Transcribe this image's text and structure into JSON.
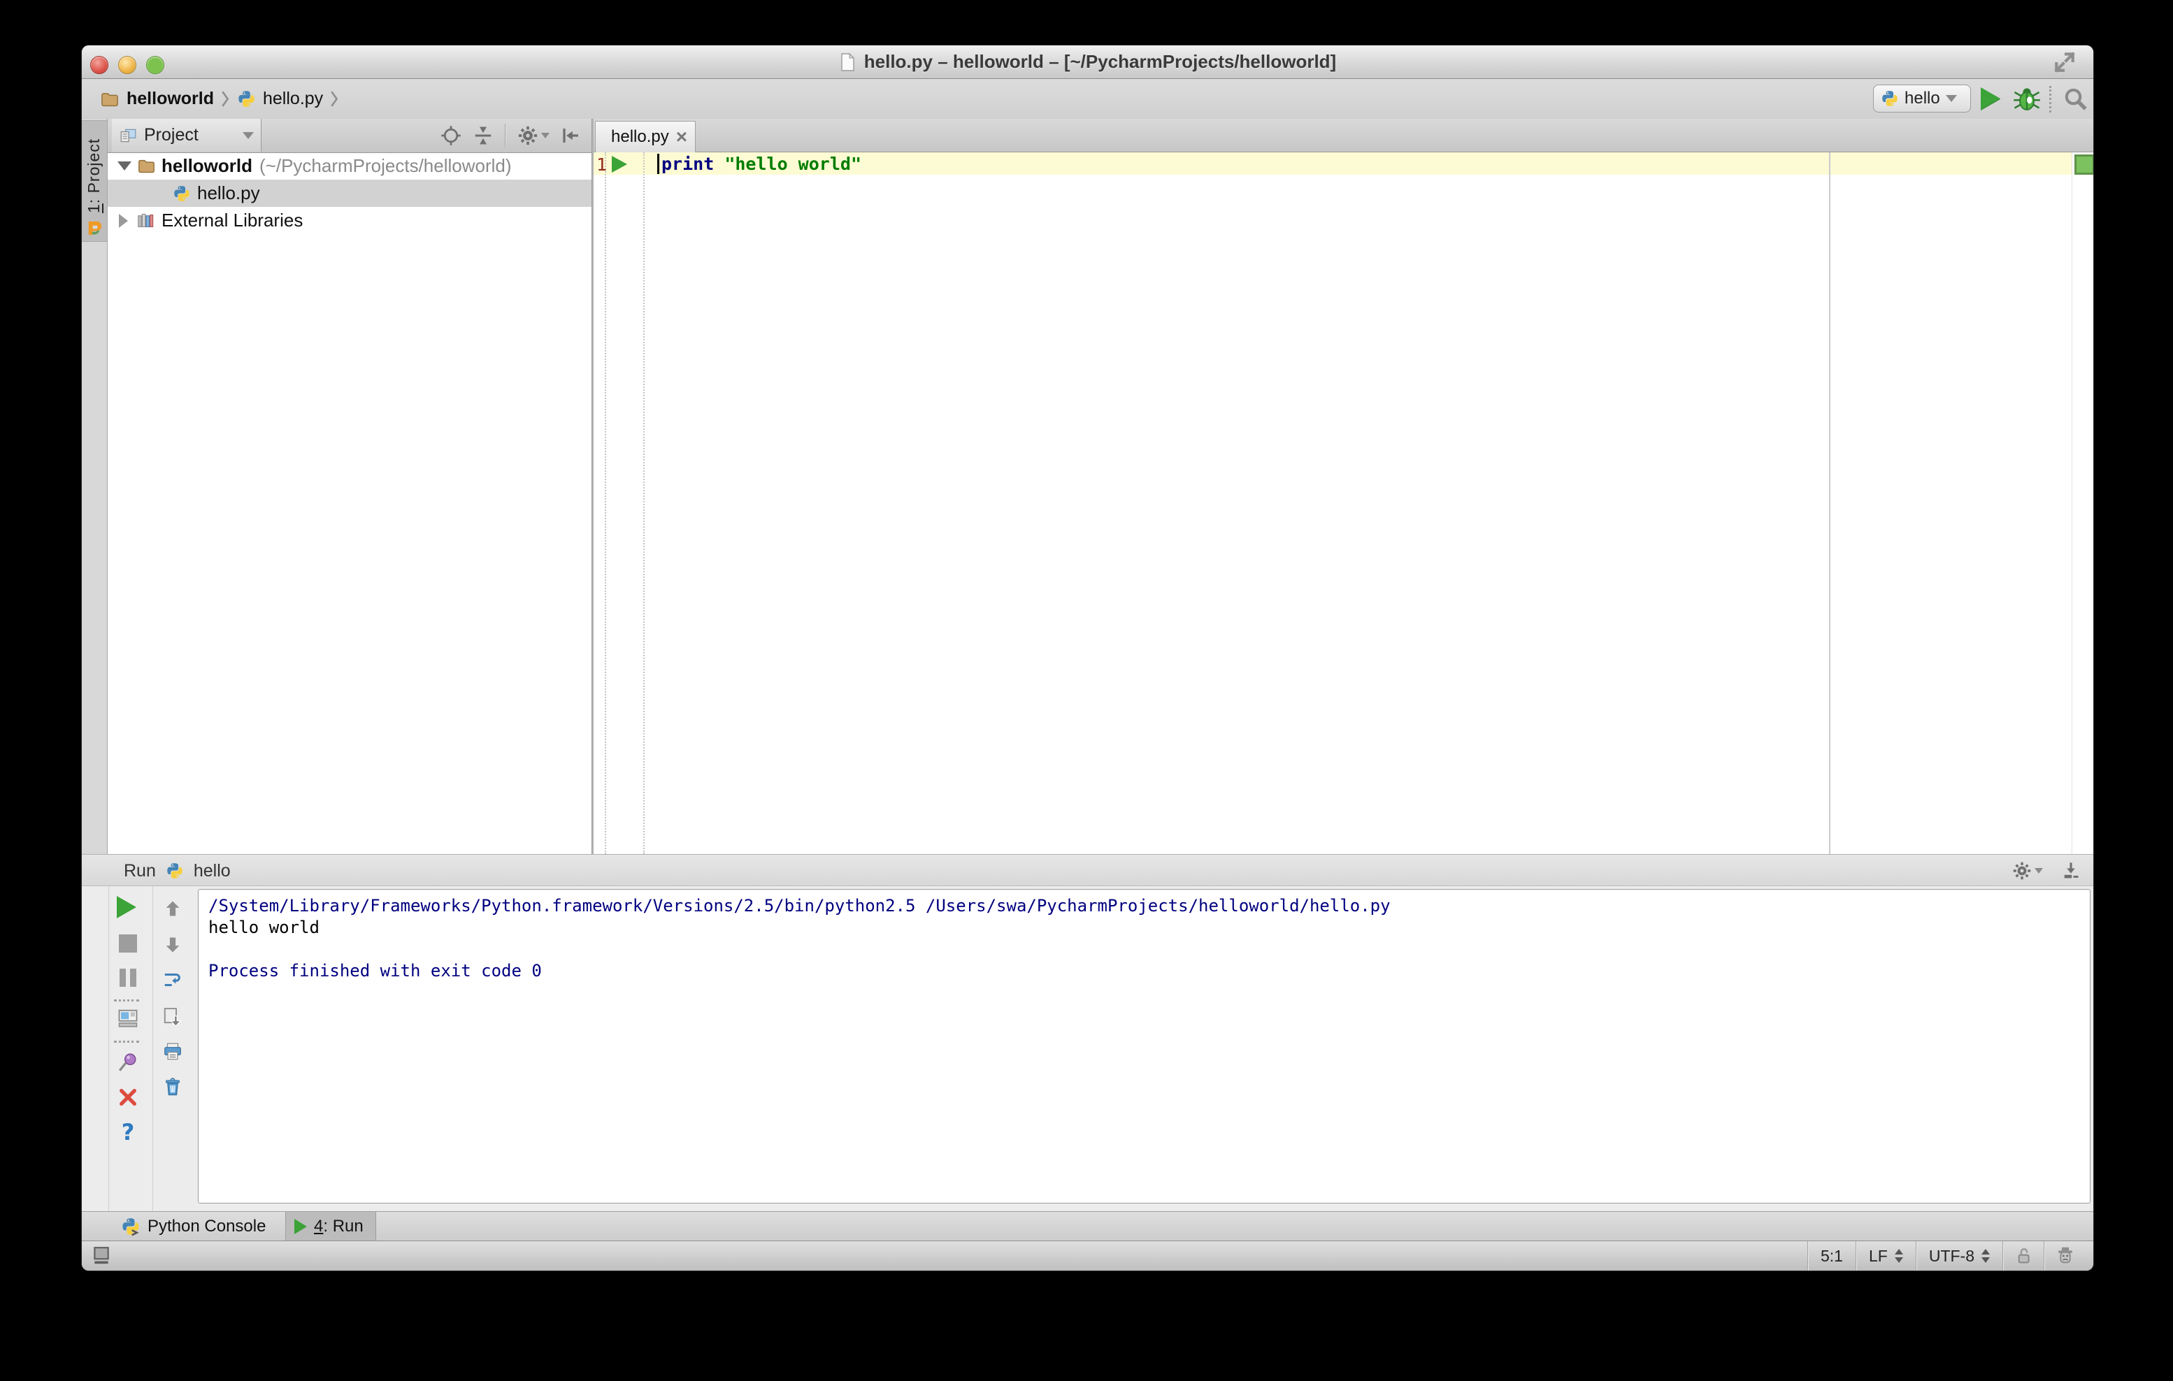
{
  "window": {
    "title": "hello.py – helloworld – [~/PycharmProjects/helloworld]"
  },
  "navbar": {
    "breadcrumbs": [
      {
        "label": "helloworld"
      },
      {
        "label": "hello.py"
      }
    ],
    "run_config": "hello"
  },
  "tool_strip": {
    "project_button_num": "1",
    "project_button_rest": ": Project"
  },
  "project_panel": {
    "header_label": "Project",
    "tree": {
      "root_label": "helloworld",
      "root_path": "(~/PycharmProjects/helloworld)",
      "file_label": "hello.py",
      "libraries_label": "External Libraries"
    }
  },
  "editor": {
    "tab_label": "hello.py",
    "line_number": "1",
    "code_keyword": "print",
    "code_string": "\"hello world\""
  },
  "run_panel": {
    "title": "Run",
    "config_name": "hello",
    "console": {
      "line1": "/System/Library/Frameworks/Python.framework/Versions/2.5/bin/python2.5 /Users/swa/PycharmProjects/helloworld/hello.py",
      "line2": "hello world",
      "line3": "",
      "line4": "Process finished with exit code 0"
    }
  },
  "bottom_bar": {
    "python_console_label": "Python Console",
    "run_tab_num": "4",
    "run_tab_rest": ": Run"
  },
  "status_bar": {
    "caret_position": "5:1",
    "line_separator": "LF",
    "encoding": "UTF-8"
  },
  "colors": {
    "keyword": "#000080",
    "string": "#007d00",
    "console_system_output": "#000080",
    "run_green": "#3ba337",
    "current_line_highlight": "#fdfbd3",
    "selection_grey": "#d2d2d2",
    "error_stripe_ok_green": "#7cc25f"
  }
}
